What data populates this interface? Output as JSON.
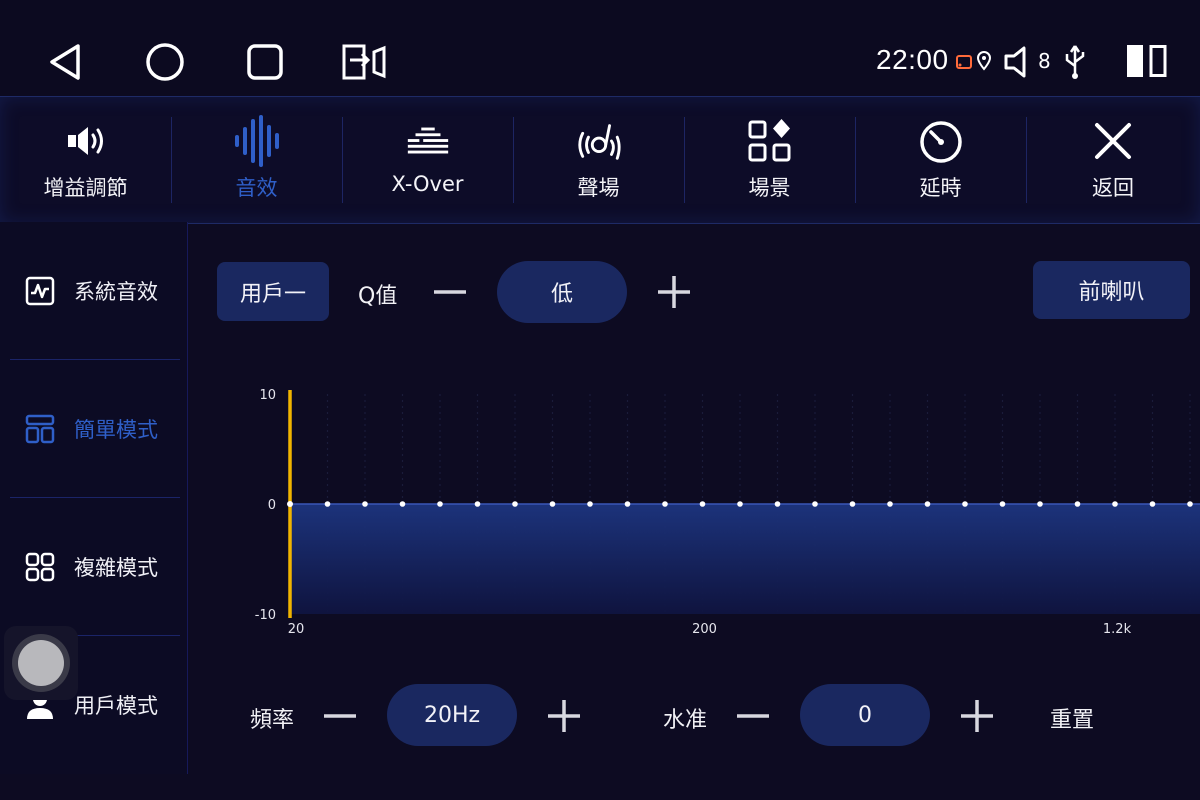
{
  "status": {
    "time": "22:00",
    "volume": "8"
  },
  "tabs": [
    {
      "label": "增益調節",
      "icon": "speaker-icon"
    },
    {
      "label": "音效",
      "icon": "soundwave-icon"
    },
    {
      "label": "X-Over",
      "icon": "equalizer-bars-icon"
    },
    {
      "label": "聲場",
      "icon": "sound-field-icon"
    },
    {
      "label": "場景",
      "icon": "scenes-grid-icon"
    },
    {
      "label": "延時",
      "icon": "timer-icon"
    },
    {
      "label": "返回",
      "icon": "close-icon"
    }
  ],
  "active_tab": 1,
  "sidebar": [
    {
      "label": "系統音效",
      "icon": "wave-chart-icon"
    },
    {
      "label": "簡單模式",
      "icon": "layout-icon"
    },
    {
      "label": "複雜模式",
      "icon": "grid-icon"
    },
    {
      "label": "用戶模式",
      "icon": "user-icon"
    }
  ],
  "active_side": 1,
  "controls": {
    "preset": "用戶一",
    "q_label": "Q值",
    "q_value": "低",
    "speaker": "前喇叭",
    "freq_label": "頻率",
    "freq_value": "20Hz",
    "level_label": "水准",
    "level_value": "0",
    "reset": "重置"
  },
  "colors": {
    "accent": "#2f5fc8",
    "fill": "#1d3580",
    "marker": "#f0b400",
    "background": "#0d0b22"
  },
  "chart_data": {
    "type": "line",
    "ylim": [
      -10,
      10
    ],
    "yticks": [
      "10",
      "0",
      "-10"
    ],
    "xticks": [
      "20",
      "200",
      "1.2k"
    ],
    "points": [
      0,
      0,
      0,
      0,
      0,
      0,
      0,
      0,
      0,
      0,
      0,
      0,
      0,
      0,
      0,
      0,
      0,
      0,
      0,
      0,
      0,
      0,
      0,
      0,
      0,
      0
    ],
    "selected_index": 0,
    "selected_label": "20"
  }
}
